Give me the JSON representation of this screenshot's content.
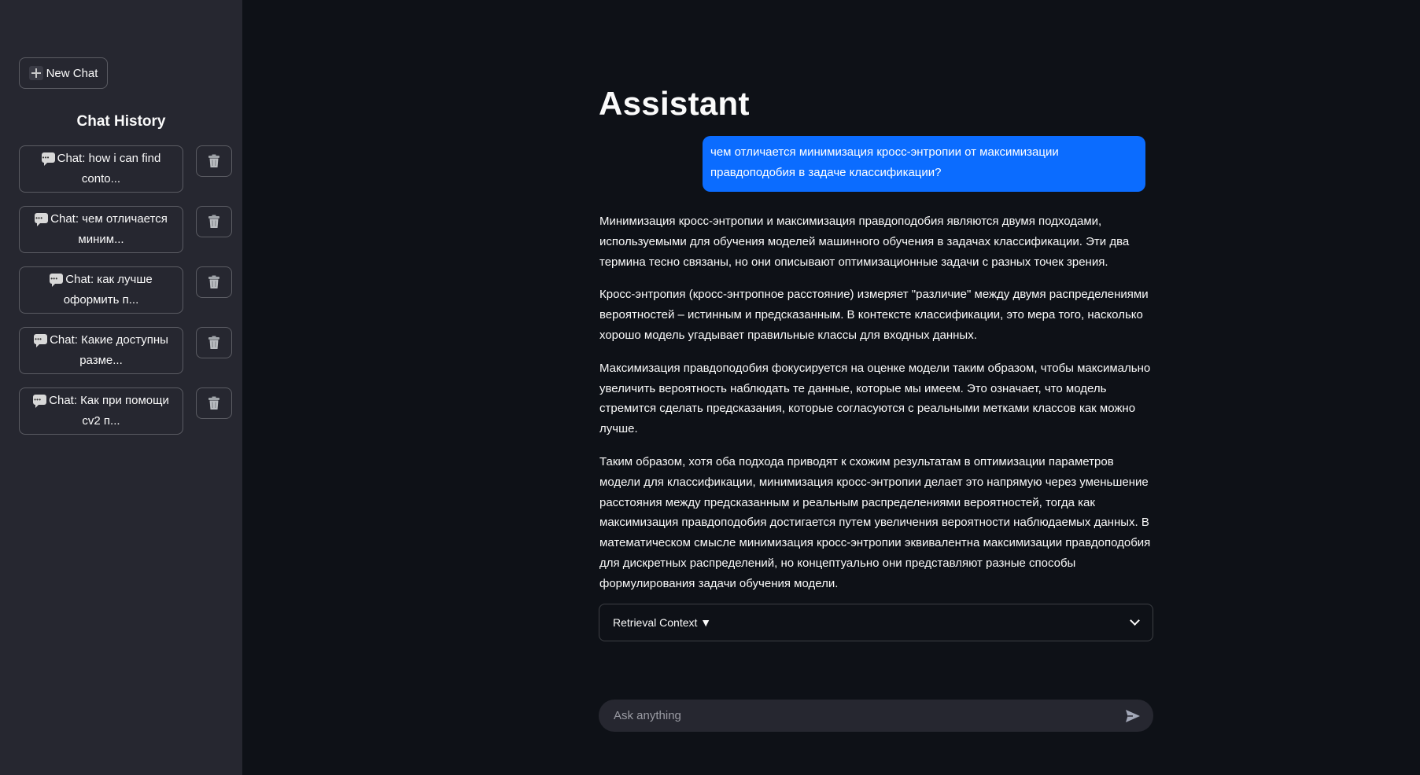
{
  "sidebar": {
    "new_chat_label": "New Chat",
    "history_title": "Chat History",
    "items": [
      {
        "line1": "Chat: how i can find",
        "line2": "conto..."
      },
      {
        "line1": "Chat: чем отличается",
        "line2": "миним..."
      },
      {
        "line1": "Chat: как лучше",
        "line2": "оформить п..."
      },
      {
        "line1": "Chat: Какие доступны",
        "line2": "разме..."
      },
      {
        "line1": "Chat: Как при помощи",
        "line2": "cv2 п..."
      }
    ]
  },
  "main": {
    "title": "Assistant",
    "user_message": "чем отличается минимизация кросс-энтропии от максимизации правдоподобия в задаче классификации?",
    "assistant_paragraphs": [
      "Минимизация кросс-энтропии и максимизация правдоподобия являются двумя подходами, используемыми для обучения моделей машинного обучения в задачах классификации. Эти два термина тесно связаны, но они описывают оптимизационные задачи с разных точек зрения.",
      "Кросс-энтропия (кросс-энтропное расстояние) измеряет \"различие\" между двумя распределениями вероятностей – истинным и предсказанным. В контексте классификации, это мера того, насколько хорошо модель угадывает правильные классы для входных данных.",
      "Максимизация правдоподобия фокусируется на оценке модели таким образом, чтобы максимально увеличить вероятность наблюдать те данные, которые мы имеем. Это означает, что модель стремится сделать предсказания, которые согласуются с реальными метками классов как можно лучше.",
      "Таким образом, хотя оба подхода приводят к схожим результатам в оптимизации параметров модели для классификации, минимизация кросс-энтропии делает это напрямую через уменьшение расстояния между предсказанным и реальным распределениями вероятностей, тогда как максимизация правдоподобия достигается путем увеличения вероятности наблюдаемых данных. В математическом смысле минимизация кросс-энтропии эквивалентна максимизации правдоподобия для дискретных распределений, но концептуально они представляют разные способы формулирования задачи обучения модели."
    ],
    "expander_label": "Retrieval Context ▼"
  },
  "input": {
    "placeholder": "Ask anything"
  },
  "colors": {
    "background": "#0e1117",
    "sidebar": "#262730",
    "user_bubble": "#0b6cff"
  }
}
